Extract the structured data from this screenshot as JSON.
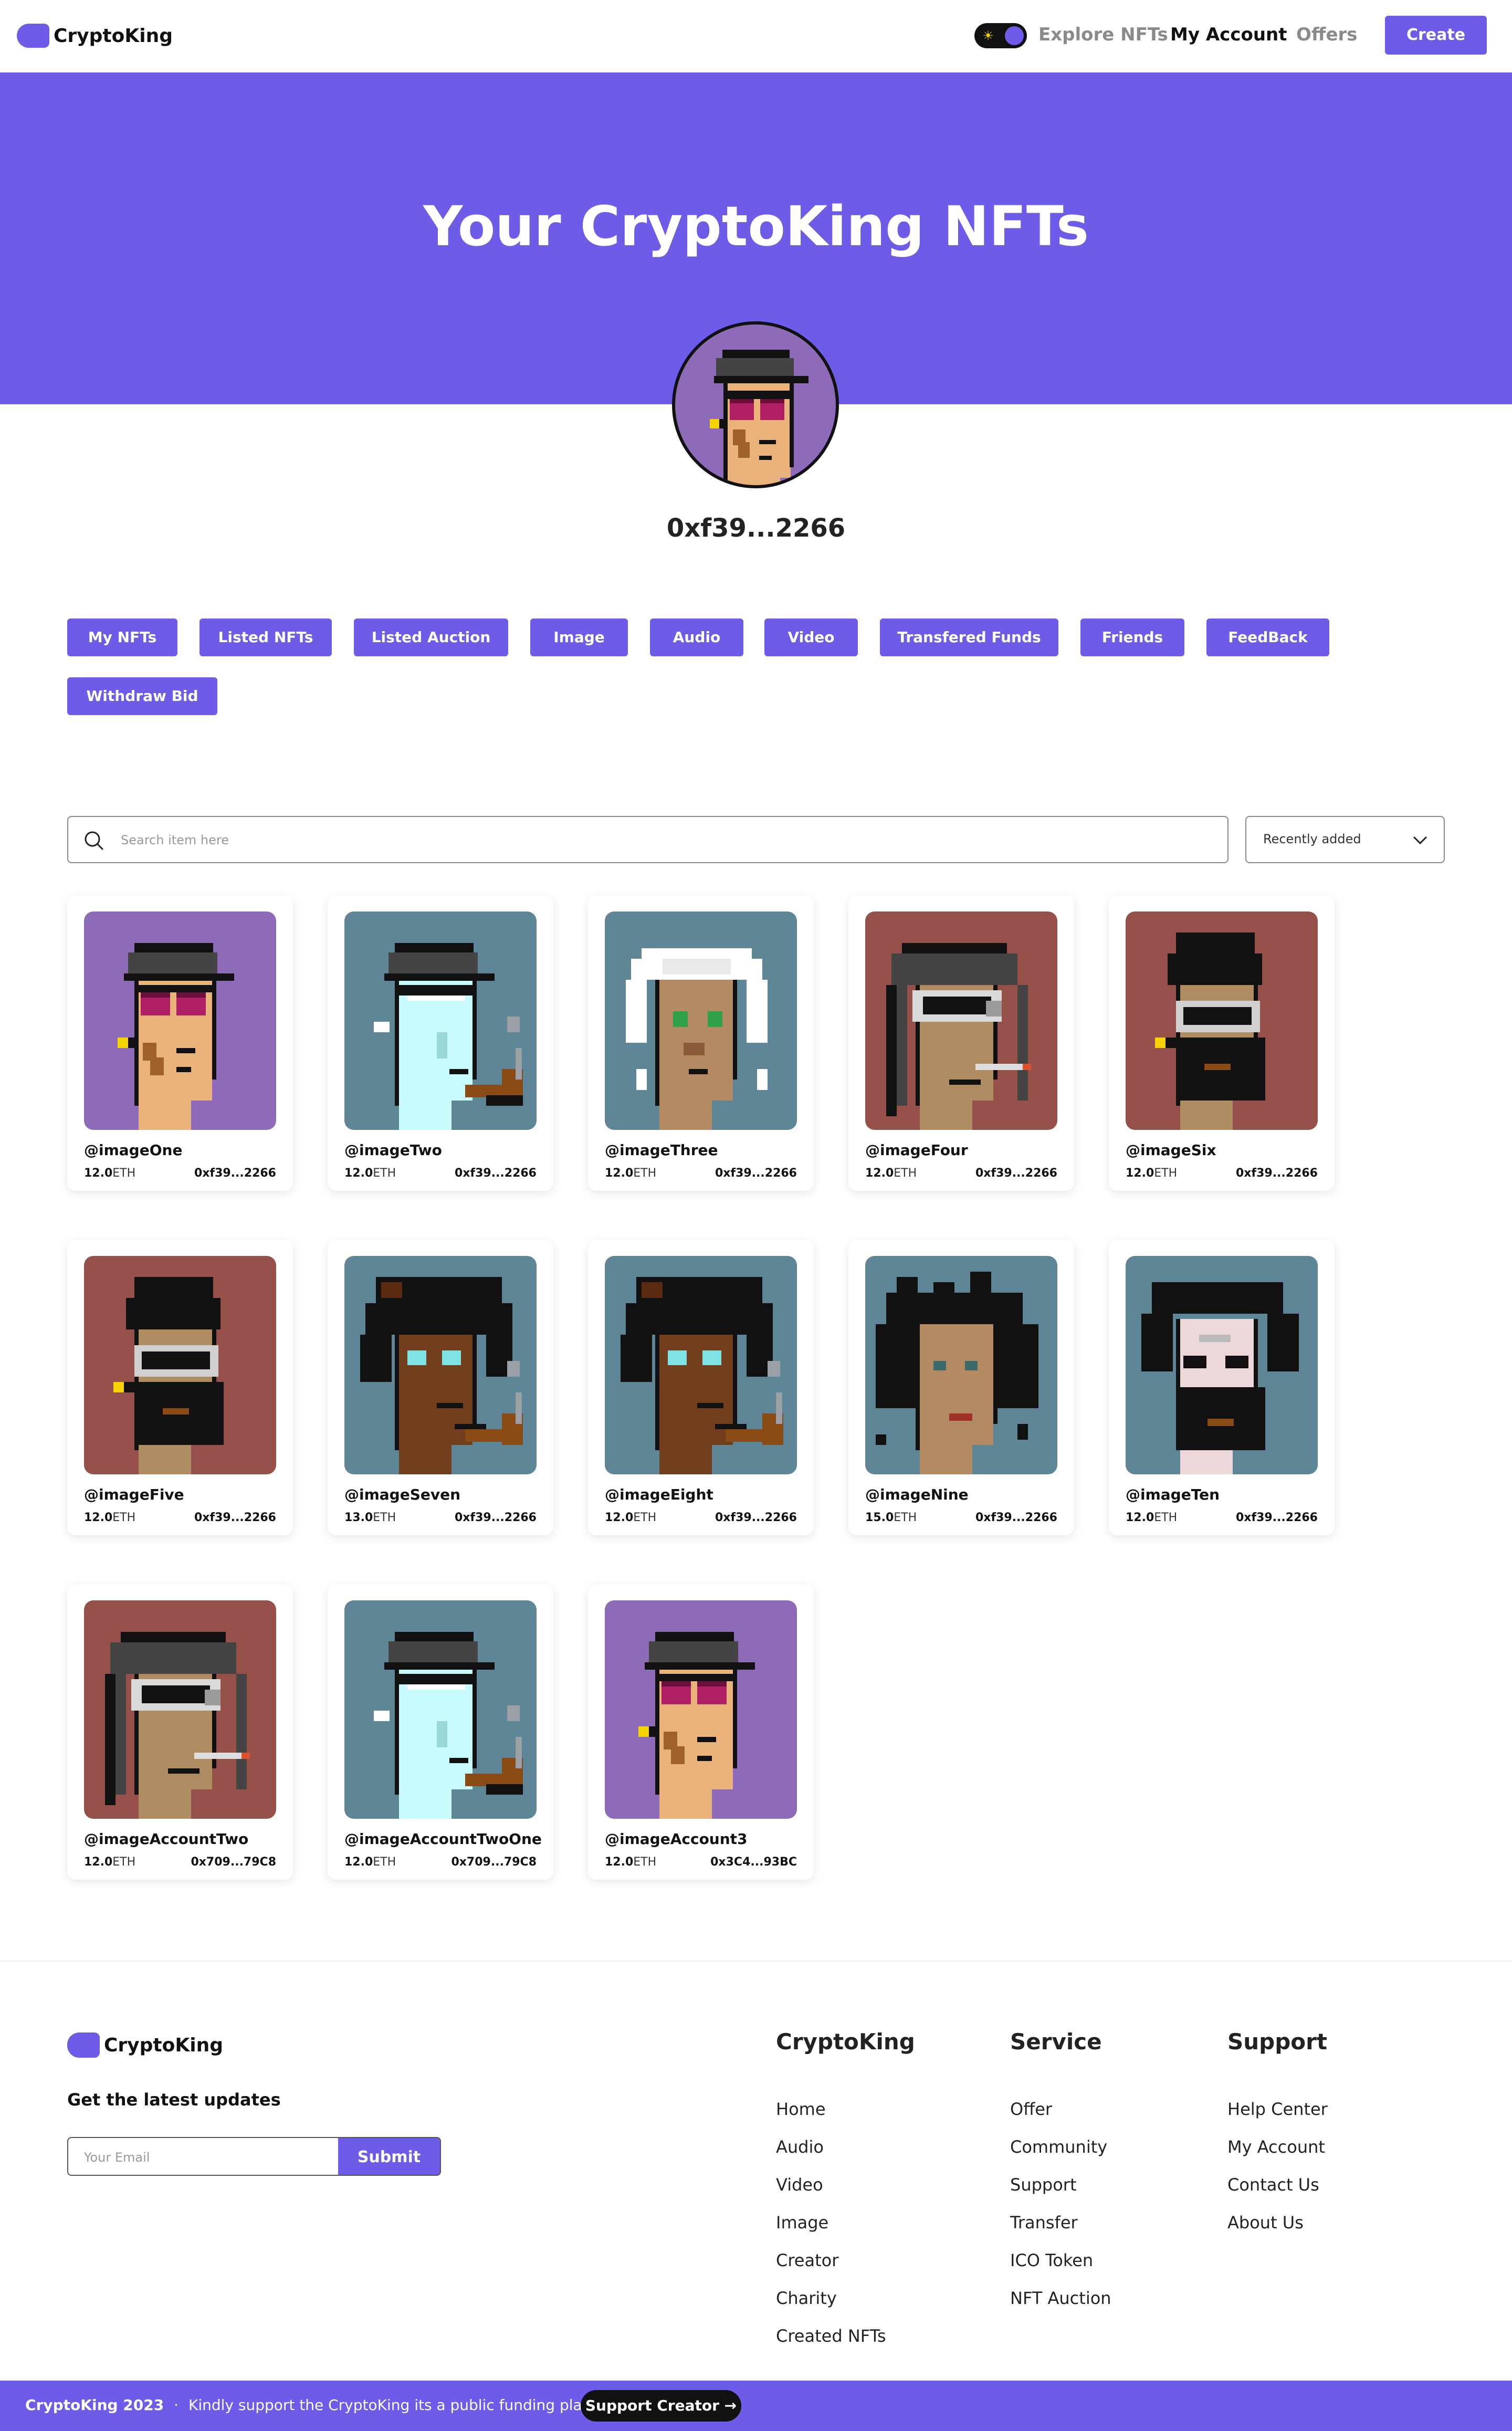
{
  "nav": {
    "logo_text": "CryptoKing",
    "links": {
      "explore": "Explore NFTs",
      "account": "My Account",
      "offers": "Offers"
    },
    "create_label": "Create",
    "theme_toggle_icon": "sun-icon"
  },
  "hero": {
    "title": "Your CryptoKing NFTs",
    "address": "0xf39...2266"
  },
  "filters": [
    "My NFTs",
    "Listed NFTs",
    "Listed Auction",
    "Image",
    "Audio",
    "Video",
    "Transfered Funds",
    "Friends",
    "FeedBack",
    "Withdraw Bid"
  ],
  "search": {
    "placeholder": "Search item here"
  },
  "sort": {
    "selected": "Recently added"
  },
  "cards": [
    {
      "name": "@imageOne",
      "price": "12.0",
      "unit": "ETH",
      "address": "0xf39...2266",
      "bg": "#8e6bb8",
      "art": "cap-goggles"
    },
    {
      "name": "@imageTwo",
      "price": "12.0",
      "unit": "ETH",
      "address": "0xf39...2266",
      "bg": "#5f8696",
      "art": "alien-pipe"
    },
    {
      "name": "@imageThree",
      "price": "12.0",
      "unit": "ETH",
      "address": "0xf39...2266",
      "bg": "#5f8696",
      "art": "white-hair"
    },
    {
      "name": "@imageFour",
      "price": "12.0",
      "unit": "ETH",
      "address": "0xf39...2266",
      "bg": "#955049",
      "art": "helmet-vr"
    },
    {
      "name": "@imageSix",
      "price": "12.0",
      "unit": "ETH",
      "address": "0xf39...2266",
      "bg": "#955049",
      "art": "beanie-beard"
    },
    {
      "name": "@imageFive",
      "price": "12.0",
      "unit": "ETH",
      "address": "0xf39...2266",
      "bg": "#955049",
      "art": "beanie-beard"
    },
    {
      "name": "@imageSeven",
      "price": "13.0",
      "unit": "ETH",
      "address": "0xf39...2266",
      "bg": "#5f8696",
      "art": "afro-pipe"
    },
    {
      "name": "@imageEight",
      "price": "12.0",
      "unit": "ETH",
      "address": "0xf39...2266",
      "bg": "#5f8696",
      "art": "afro-pipe"
    },
    {
      "name": "@imageNine",
      "price": "15.0",
      "unit": "ETH",
      "address": "0xf39...2266",
      "bg": "#5f8696",
      "art": "wild-hair"
    },
    {
      "name": "@imageTen",
      "price": "12.0",
      "unit": "ETH",
      "address": "0xf39...2266",
      "bg": "#5f8696",
      "art": "pale-beard"
    },
    {
      "name": "@imageAccountTwo",
      "price": "12.0",
      "unit": "ETH",
      "address": "0x709...79C8",
      "bg": "#955049",
      "art": "helmet-vr"
    },
    {
      "name": "@imageAccountTwoOne",
      "price": "12.0",
      "unit": "ETH",
      "address": "0x709...79C8",
      "bg": "#5f8696",
      "art": "alien-pipe"
    },
    {
      "name": "@imageAccount3",
      "price": "12.0",
      "unit": "ETH",
      "address": "0x3C4...93BC",
      "bg": "#8e6bb8",
      "art": "cap-goggles"
    }
  ],
  "footer": {
    "logo_text": "CryptoKing",
    "updates_label": "Get the latest updates",
    "email_placeholder": "Your Email",
    "submit_label": "Submit",
    "columns": [
      {
        "title": "CryptoKing",
        "links": [
          "Home",
          "Audio",
          "Video",
          "Image",
          "Creator",
          "Charity",
          "Created NFTs"
        ]
      },
      {
        "title": "Service",
        "links": [
          "Offer",
          "Community",
          "Support",
          "Transfer",
          "ICO Token",
          "NFT Auction"
        ]
      },
      {
        "title": "Support",
        "links": [
          "Help Center",
          "My Account",
          "Contact Us",
          "About Us"
        ]
      }
    ]
  },
  "bottom_bar": {
    "copyright": "CryptoKing 2023",
    "separator": "·",
    "message": "Kindly support the CryptoKing its a public funding platform",
    "button_label": "Support Creator →"
  },
  "colors": {
    "accent": "#6c5ce7",
    "dark": "#111111",
    "muted": "#8a8a8a"
  }
}
